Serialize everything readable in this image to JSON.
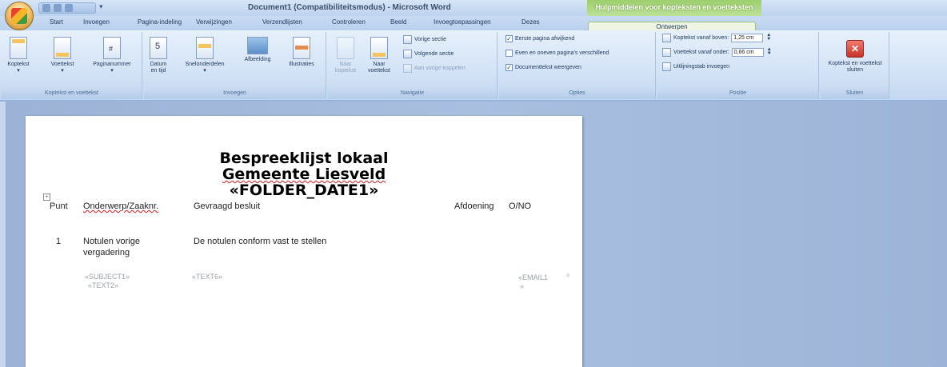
{
  "window": {
    "title": "Document1 (Compatibiliteitsmodus) - Microsoft Word",
    "context_tools_title": "Hulpmiddelen voor kopteksten en voetteksten"
  },
  "tabs": [
    {
      "label": "Start"
    },
    {
      "label": "Invoegen"
    },
    {
      "label": "Pagina-indeling"
    },
    {
      "label": "Verwijzingen"
    },
    {
      "label": "Verzendlijsten"
    },
    {
      "label": "Controleren"
    },
    {
      "label": "Beeld"
    },
    {
      "label": "Invoegtoepassingen"
    },
    {
      "label": "Dezes"
    },
    {
      "label": "Ontwerpen"
    }
  ],
  "ribbon": {
    "groups": {
      "header_footer": {
        "label": "Koptekst en voettekst",
        "buttons": [
          "Koptekst",
          "Voettekst",
          "Paginanummer"
        ]
      },
      "insert": {
        "label": "Invoegen",
        "buttons": [
          "Datum en tijd",
          "Snelonderdelen",
          "Afbeelding",
          "Illustraties"
        ]
      },
      "navigation": {
        "label": "Navigatie",
        "buttons": [
          "Naar koptekst",
          "Naar voettekst"
        ],
        "small": [
          "Vorige sectie",
          "Volgende sectie",
          "Aan vorige koppelen"
        ]
      },
      "options": {
        "label": "Opties",
        "checks": [
          {
            "label": "Eerste pagina afwijkend",
            "checked": "✓"
          },
          {
            "label": "Even en oneven pagina's verschillend",
            "checked": ""
          },
          {
            "label": "Documenttekst weergeven",
            "checked": "✓"
          }
        ]
      },
      "position": {
        "label": "Positie",
        "header_from_top_label": "Koptekst vanaf boven:",
        "header_from_top_value": "1,25 cm",
        "footer_from_bottom_label": "Voettekst vanaf onder:",
        "footer_from_bottom_value": "0,66 cm",
        "insert_tab_label": "Uitlijningstab invoegen"
      },
      "close": {
        "label": "Sluiten",
        "button": "Koptekst en voettekst sluiten"
      }
    }
  },
  "document": {
    "title_lines": [
      "Bespreeklijst lokaal",
      "Gemeente Liesveld",
      "«FOLDER_DATE1»"
    ],
    "table_headers": {
      "punt": "Punt",
      "onderwerp": "Onderwerp/Zaaknr.",
      "gevraagd": "Gevraagd besluit",
      "afdoening": "Afdoening",
      "ono": "O/NO"
    },
    "row1": {
      "punt": "1",
      "onderwerp": "Notulen vorige vergadering",
      "gevraagd": "De notulen  conform vast te stellen"
    },
    "fields": {
      "subject": "«SUBJECT1»",
      "text2": "«TEXT2»",
      "text6": "«TEXT6»",
      "email": "«EMAIL1",
      "email_tail": "»"
    }
  }
}
